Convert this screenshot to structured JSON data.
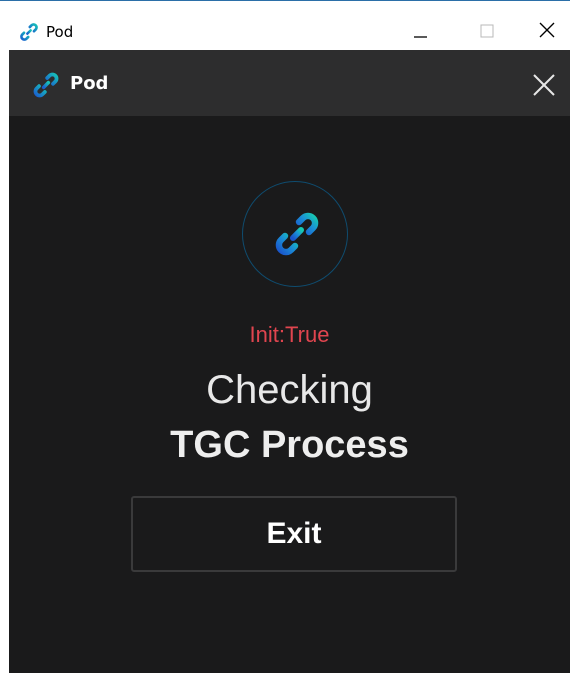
{
  "window": {
    "title": "Pod"
  },
  "app": {
    "title": "Pod",
    "status": "Init:True",
    "heading": "Checking",
    "subheading": "TGC Process",
    "exit_label": "Exit"
  },
  "colors": {
    "status": "#e0454f",
    "background": "#1a1a1b",
    "header": "#2d2d2e",
    "accent_blue": "#1a6fd6",
    "accent_cyan": "#17c3b8"
  },
  "icons": {
    "app": "chain-link-icon",
    "minimize": "minimize-icon",
    "maximize": "maximize-icon",
    "close": "close-icon"
  }
}
